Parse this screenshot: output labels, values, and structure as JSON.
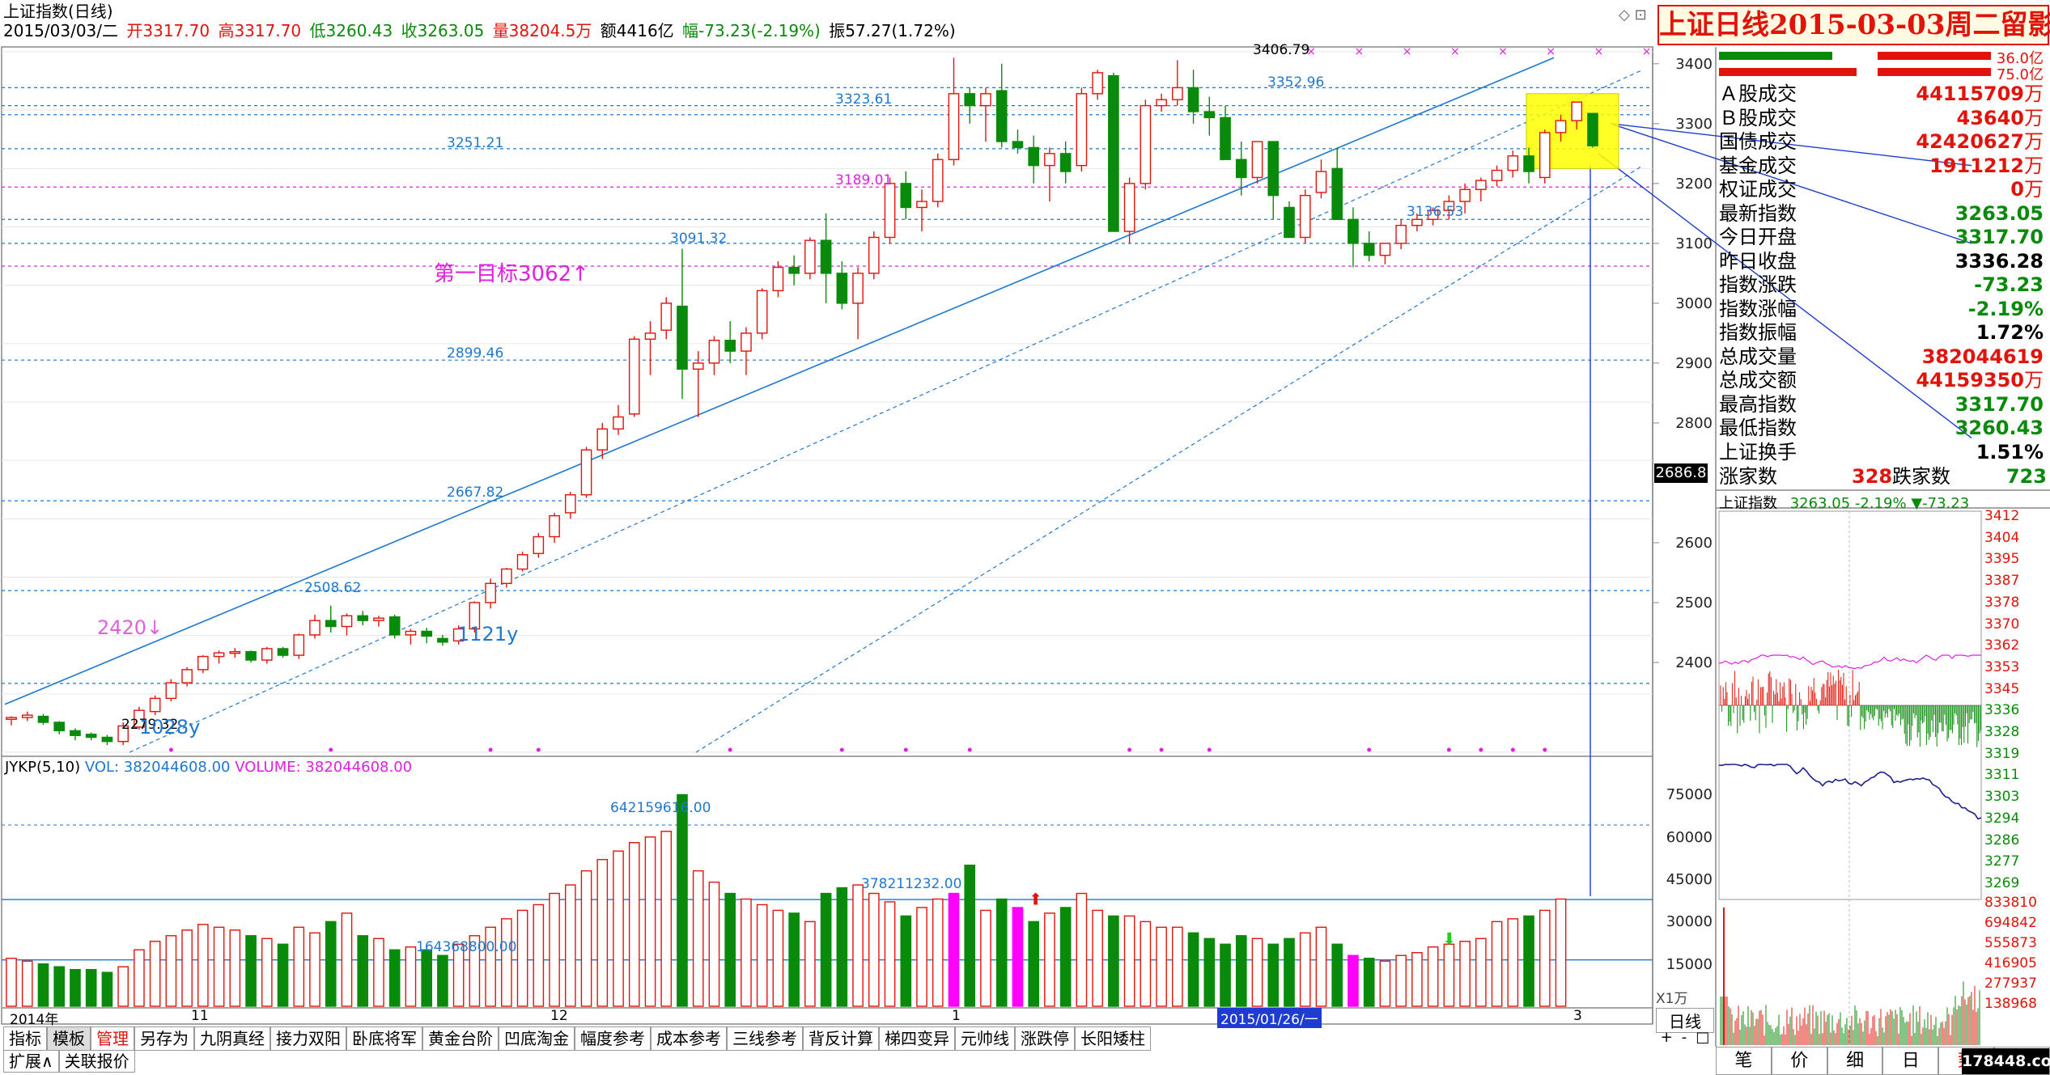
{
  "header": {
    "title": "上证指数(日线)",
    "date": "2015/03/03/二",
    "open": "开3317.70",
    "high": "高3317.70",
    "low": "低3260.43",
    "close": "收3263.05",
    "vol": "量38204.5万",
    "amt": "额4416亿",
    "chg": "幅-73.23(-2.19%)",
    "amp": "振57.27(1.72%)"
  },
  "stamp": "上证日线2015-03-03周二留影",
  "price_axis": [
    "3400",
    "3300",
    "3200",
    "3100",
    "3000",
    "2900",
    "2800",
    "2600",
    "2500",
    "2400"
  ],
  "price_tag": "2686.8",
  "vol_axis": [
    "75000",
    "60000",
    "45000",
    "30000",
    "15000"
  ],
  "vol_unit": "X1万",
  "price_levels": [
    {
      "t": "3323.61",
      "c": "#1e78d2"
    },
    {
      "t": "3251.21",
      "c": "#1e78d2"
    },
    {
      "t": "3189.01",
      "c": "#e020e0"
    },
    {
      "t": "3091.32",
      "c": "#1e78d2"
    },
    {
      "t": "2899.46",
      "c": "#1e78d2"
    },
    {
      "t": "2667.82",
      "c": "#1e78d2"
    },
    {
      "t": "2508.62",
      "c": "#1e78d2"
    },
    {
      "t": "3406.79",
      "c": "#000"
    },
    {
      "t": "3352.96",
      "c": "#1e78d2"
    },
    {
      "t": "3136.53",
      "c": "#1e78d2"
    },
    {
      "t": "2279.32",
      "c": "#000"
    }
  ],
  "annotations": {
    "target": "第一目标3062↑",
    "a2420": "2420↓",
    "a1121": "1121y",
    "a1028": "1028y"
  },
  "indicator": {
    "name": "JYKP(5,10)",
    "vol": "VOL: 382044608.00",
    "volume": "VOLUME: 382044608.00",
    "lbl1": "642159616.00",
    "lbl2": "378211232.00",
    "lbl3": "164368800.00"
  },
  "date_axis": [
    "2014年",
    "11",
    "12",
    "1",
    "2015/01/26/一",
    "3"
  ],
  "period": "日线",
  "quote": {
    "v1": "36.0亿",
    "v2": "75.0亿"
  },
  "stats": [
    {
      "k": "Ａ股成交",
      "v": "44115709",
      "u": "万",
      "c": "red"
    },
    {
      "k": "Ｂ股成交",
      "v": "43640",
      "u": "万",
      "c": "red"
    },
    {
      "k": "国债成交",
      "v": "42420627",
      "u": "万",
      "c": "red"
    },
    {
      "k": "基金成交",
      "v": "1911212",
      "u": "万",
      "c": "red"
    },
    {
      "k": "权证成交",
      "v": "0",
      "u": "万",
      "c": "red"
    },
    {
      "k": "最新指数",
      "v": "3263.05",
      "u": "",
      "c": "grn"
    },
    {
      "k": "今日开盘",
      "v": "3317.70",
      "u": "",
      "c": "grn"
    },
    {
      "k": "昨日收盘",
      "v": "3336.28",
      "u": "",
      "c": "blk"
    },
    {
      "k": "指数涨跌",
      "v": "-73.23",
      "u": "",
      "c": "grn"
    },
    {
      "k": "指数涨幅",
      "v": "-2.19%",
      "u": "",
      "c": "grn"
    },
    {
      "k": "指数振幅",
      "v": "1.72%",
      "u": "",
      "c": "blk"
    },
    {
      "k": "总成交量",
      "v": "382044619",
      "u": "",
      "c": "red"
    },
    {
      "k": "总成交额",
      "v": "44159350",
      "u": "万",
      "c": "red"
    },
    {
      "k": "最高指数",
      "v": "3317.70",
      "u": "",
      "c": "grn"
    },
    {
      "k": "最低指数",
      "v": "3260.43",
      "u": "",
      "c": "grn"
    },
    {
      "k": "上证换手",
      "v": "1.51%",
      "u": "",
      "c": "blk"
    }
  ],
  "breadth": {
    "up_lbl": "涨家数",
    "up": "328",
    "dn_lbl": "跌家数",
    "dn": "723"
  },
  "mini": {
    "name": "上证指数",
    "price": "3263.05",
    "pct": "-2.19%",
    "chg": "▼-73.23",
    "axis": [
      "3412",
      "3404",
      "3395",
      "3387",
      "3378",
      "3370",
      "3362",
      "3353",
      "3345",
      "3336",
      "3328",
      "3319",
      "3311",
      "3303",
      "3294",
      "3286",
      "3277",
      "3269"
    ],
    "vaxis": [
      "833810",
      "694842",
      "555873",
      "416905",
      "277937",
      "138968"
    ]
  },
  "tabs": [
    "指标",
    "模板",
    "管理",
    "另存为",
    "九阴真经",
    "接力双阳",
    "卧底将军",
    "黄金台阶",
    "凹底淘金",
    "幅度参考",
    "成本参考",
    "三线参考",
    "背反计算",
    "梯四变异",
    "元帅线",
    "涨跌停",
    "长阳矮柱"
  ],
  "bottom": [
    "扩展∧",
    "关联报价"
  ],
  "controls": [
    "+",
    "-",
    "□"
  ],
  "btabs": [
    "笔",
    "价",
    "细",
    "日",
    "势",
    "联"
  ],
  "watermark": "178448.com",
  "chart_data": {
    "type": "candlestick",
    "title": "上证指数(日线)",
    "candles": [
      [
        2305,
        2310,
        2295,
        2308
      ],
      [
        2308,
        2318,
        2302,
        2312
      ],
      [
        2310,
        2314,
        2296,
        2300
      ],
      [
        2300,
        2302,
        2280,
        2286
      ],
      [
        2286,
        2290,
        2270,
        2278
      ],
      [
        2280,
        2283,
        2270,
        2275
      ],
      [
        2275,
        2279,
        2262,
        2268
      ],
      [
        2268,
        2300,
        2262,
        2294
      ],
      [
        2292,
        2326,
        2288,
        2320
      ],
      [
        2318,
        2345,
        2312,
        2340
      ],
      [
        2340,
        2372,
        2335,
        2366
      ],
      [
        2366,
        2392,
        2360,
        2388
      ],
      [
        2388,
        2412,
        2382,
        2410
      ],
      [
        2410,
        2420,
        2398,
        2416
      ],
      [
        2416,
        2424,
        2408,
        2418
      ],
      [
        2418,
        2420,
        2400,
        2404
      ],
      [
        2404,
        2426,
        2398,
        2423
      ],
      [
        2423,
        2426,
        2408,
        2412
      ],
      [
        2412,
        2448,
        2406,
        2446
      ],
      [
        2446,
        2480,
        2440,
        2470
      ],
      [
        2470,
        2495,
        2450,
        2460
      ],
      [
        2460,
        2482,
        2445,
        2478
      ],
      [
        2478,
        2486,
        2462,
        2470
      ],
      [
        2470,
        2478,
        2460,
        2474
      ],
      [
        2476,
        2480,
        2440,
        2446
      ],
      [
        2446,
        2456,
        2430,
        2452
      ],
      [
        2452,
        2458,
        2432,
        2444
      ],
      [
        2440,
        2446,
        2428,
        2434
      ],
      [
        2436,
        2462,
        2430,
        2456
      ],
      [
        2456,
        2502,
        2450,
        2500
      ],
      [
        2500,
        2540,
        2490,
        2532
      ],
      [
        2532,
        2558,
        2525,
        2556
      ],
      [
        2556,
        2585,
        2552,
        2580
      ],
      [
        2582,
        2616,
        2575,
        2610
      ],
      [
        2610,
        2650,
        2600,
        2645
      ],
      [
        2650,
        2685,
        2640,
        2680
      ],
      [
        2680,
        2760,
        2675,
        2755
      ],
      [
        2755,
        2800,
        2740,
        2790
      ],
      [
        2790,
        2830,
        2780,
        2810
      ],
      [
        2815,
        2945,
        2810,
        2940
      ],
      [
        2940,
        2970,
        2880,
        2950
      ],
      [
        2955,
        3010,
        2940,
        3000
      ],
      [
        2995,
        3091,
        2840,
        2890
      ],
      [
        2890,
        2920,
        2810,
        2900
      ],
      [
        2900,
        2945,
        2880,
        2938
      ],
      [
        2938,
        2970,
        2900,
        2920
      ],
      [
        2920,
        2960,
        2880,
        2950
      ],
      [
        2950,
        3025,
        2940,
        3021
      ],
      [
        3021,
        3070,
        3010,
        3060
      ],
      [
        3060,
        3080,
        3030,
        3050
      ],
      [
        3050,
        3110,
        3040,
        3105
      ],
      [
        3105,
        3150,
        3000,
        3050
      ],
      [
        3050,
        3070,
        2990,
        3000
      ],
      [
        3000,
        3060,
        2940,
        3050
      ],
      [
        3050,
        3120,
        3040,
        3110
      ],
      [
        3110,
        3210,
        3100,
        3200
      ],
      [
        3200,
        3220,
        3140,
        3160
      ],
      [
        3160,
        3190,
        3120,
        3170
      ],
      [
        3170,
        3250,
        3160,
        3240
      ],
      [
        3240,
        3410,
        3230,
        3350
      ],
      [
        3350,
        3360,
        3300,
        3330
      ],
      [
        3330,
        3360,
        3270,
        3350
      ],
      [
        3355,
        3400,
        3260,
        3270
      ],
      [
        3270,
        3290,
        3250,
        3260
      ],
      [
        3260,
        3280,
        3200,
        3230
      ],
      [
        3230,
        3260,
        3170,
        3250
      ],
      [
        3250,
        3270,
        3200,
        3220
      ],
      [
        3230,
        3360,
        3220,
        3350
      ],
      [
        3350,
        3390,
        3340,
        3385
      ],
      [
        3380,
        3385,
        3180,
        3120
      ],
      [
        3120,
        3210,
        3100,
        3200
      ],
      [
        3200,
        3340,
        3190,
        3330
      ],
      [
        3330,
        3350,
        3320,
        3340
      ],
      [
        3340,
        3406,
        3330,
        3360
      ],
      [
        3360,
        3390,
        3300,
        3320
      ],
      [
        3320,
        3345,
        3280,
        3310
      ],
      [
        3310,
        3330,
        3260,
        3240
      ],
      [
        3240,
        3270,
        3180,
        3210
      ],
      [
        3210,
        3270,
        3200,
        3270
      ],
      [
        3270,
        3220,
        3140,
        3180
      ],
      [
        3160,
        3170,
        3120,
        3110
      ],
      [
        3110,
        3190,
        3100,
        3180
      ],
      [
        3185,
        3240,
        3175,
        3220
      ],
      [
        3225,
        3260,
        3190,
        3140
      ],
      [
        3140,
        3160,
        3060,
        3100
      ],
      [
        3100,
        3120,
        3070,
        3080
      ],
      [
        3080,
        3090,
        3065,
        3100
      ],
      [
        3100,
        3140,
        3090,
        3130
      ],
      [
        3130,
        3150,
        3120,
        3140
      ],
      [
        3140,
        3160,
        3130,
        3155
      ],
      [
        3155,
        3180,
        3140,
        3170
      ],
      [
        3170,
        3200,
        3150,
        3190
      ],
      [
        3190,
        3210,
        3170,
        3205
      ],
      [
        3205,
        3230,
        3195,
        3222
      ],
      [
        3222,
        3255,
        3210,
        3246
      ],
      [
        3246,
        3260,
        3200,
        3220
      ],
      [
        3210,
        3290,
        3200,
        3285
      ],
      [
        3285,
        3315,
        3270,
        3305
      ],
      [
        3305,
        3336,
        3290,
        3336
      ],
      [
        3317,
        3317,
        3260,
        3263
      ]
    ],
    "volume": [
      17,
      16,
      15,
      14,
      13,
      13,
      12,
      14,
      20,
      23,
      25,
      27,
      29,
      28,
      27,
      25,
      24,
      22,
      28,
      26,
      30,
      33,
      25,
      24,
      20,
      21,
      20,
      18,
      22,
      25,
      28,
      31,
      34,
      36,
      40,
      43,
      48,
      52,
      55,
      58,
      60,
      62,
      75,
      48,
      44,
      40,
      38,
      36,
      34,
      33,
      30,
      40,
      42,
      43,
      40,
      37,
      32,
      35,
      38,
      40,
      50,
      34,
      38,
      35,
      30,
      33,
      35,
      40,
      34,
      32,
      32,
      30,
      28,
      28,
      26,
      24,
      22,
      25,
      24,
      22,
      24,
      26,
      28,
      22,
      18,
      17,
      16,
      18,
      19,
      21,
      22,
      23,
      24,
      30,
      31,
      32,
      34,
      38
    ],
    "ylim": [
      2250,
      3420
    ],
    "vol_ylim": [
      0,
      80000
    ]
  }
}
